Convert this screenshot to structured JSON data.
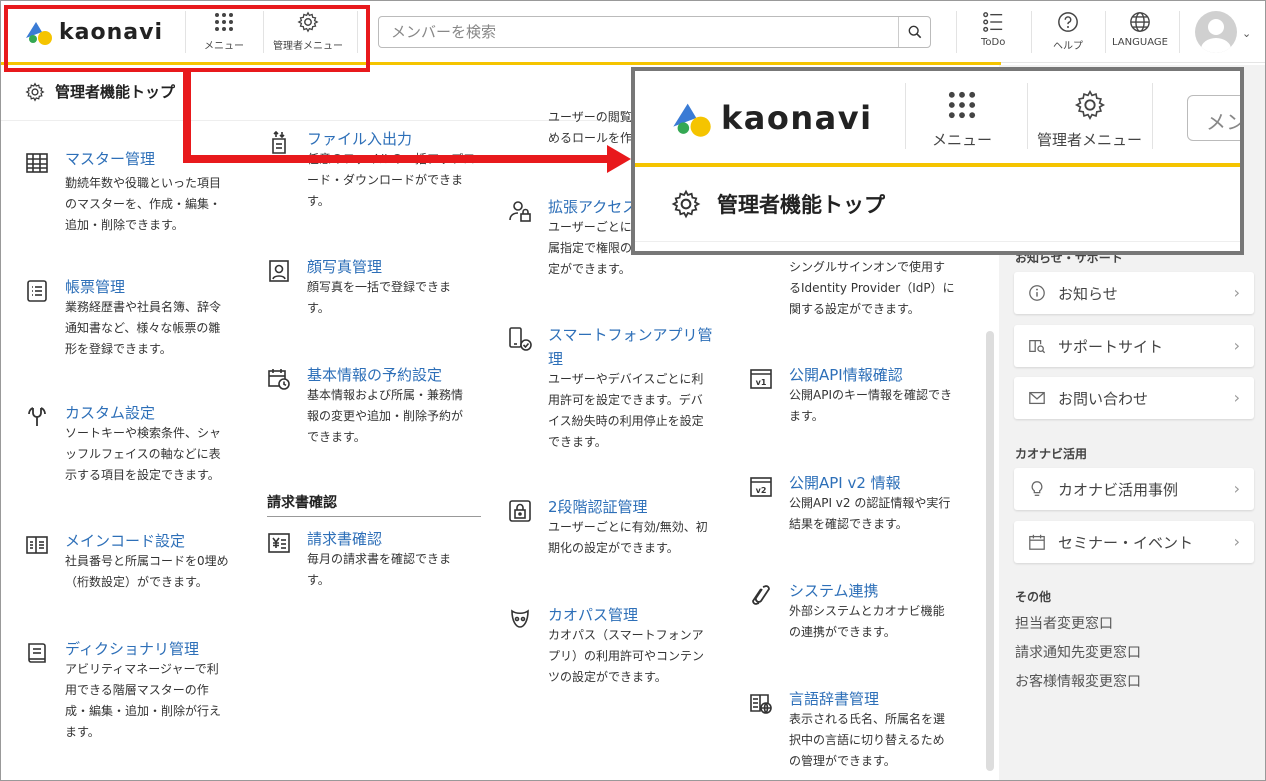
{
  "header": {
    "logo_text": "kaonavi",
    "menu_label": "メニュー",
    "admin_menu_label": "管理者メニュー",
    "search_placeholder": "メンバーを検索",
    "todo_label": "ToDo",
    "help_label": "ヘルプ",
    "language_label": "LANGUAGE"
  },
  "breadcrumb": {
    "title": "管理者機能トップ"
  },
  "main": {
    "col1": [
      {
        "icon": "table-icon",
        "title": "マスター管理",
        "desc": [
          "勤続年数や役職といった項目",
          "のマスターを、作成・編集・",
          "追加・削除できます。"
        ]
      },
      {
        "icon": "list-icon",
        "title": "帳票管理",
        "desc": [
          "業務経歴書や社員名簿、辞令",
          "通知書など、様々な帳票の雛",
          "形を登録できます。"
        ]
      },
      {
        "icon": "wrench-icon",
        "title": "カスタム設定",
        "desc": [
          "ソートキーや検索条件、シャ",
          "ッフルフェイスの軸などに表",
          "示する項目を設定できます。"
        ]
      },
      {
        "icon": "code-icon",
        "title": "メインコード設定",
        "desc": [
          "社員番号と所属コードを0埋め",
          "（桁数設定）ができます。"
        ]
      },
      {
        "icon": "book-icon",
        "title": "ディクショナリ管理",
        "desc": [
          "アビリティマネージャーで利",
          "用できる階層マスターの作",
          "成・編集・追加・削除が行え",
          "ます。"
        ]
      }
    ],
    "col2": [
      {
        "icon": "file-transfer-icon",
        "title": "ファイル入出力",
        "desc": [
          "任意のファイルの一括アップロ",
          "ード・ダウンロードができま",
          "す。"
        ]
      },
      {
        "icon": "portrait-icon",
        "title": "顔写真管理",
        "desc": [
          "顔写真を一括で登録できま",
          "す。"
        ]
      },
      {
        "icon": "calendar-clock-icon",
        "title": "基本情報の予約設定",
        "desc": [
          "基本情報および所属・兼務情",
          "報の変更や追加・削除予約が",
          "できます。"
        ]
      }
    ],
    "billing_header": "請求書確認",
    "billing_item": {
      "icon": "invoice-icon",
      "title": "請求書確認",
      "desc": [
        "毎月の請求書を確認できま",
        "す。"
      ]
    },
    "col3": [
      {
        "icon": "none",
        "title": "",
        "desc": [
          "ユーザーの閲覧",
          "めるロールを作"
        ]
      },
      {
        "icon": "user-lock-icon",
        "title": "拡張アクセス",
        "desc": [
          "ユーザーごとに",
          "属指定で権限の",
          "定ができます。"
        ]
      },
      {
        "icon": "phone-check-icon",
        "title": "スマートフォンアプリ管理",
        "desc": [
          "ユーザーやデバイスごとに利",
          "用許可を設定できます。デバ",
          "イス紛失時の利用停止を設定",
          "できます。"
        ]
      },
      {
        "icon": "two-factor-icon",
        "title": "2段階認証管理",
        "desc": [
          "ユーザーごとに有効/無効、初",
          "期化の設定ができます。"
        ]
      },
      {
        "icon": "kaopass-icon",
        "title": "カオパス管理",
        "desc": [
          "カオパス（スマートフォンア",
          "プリ）の利用許可やコンテン",
          "ツの設定ができます。"
        ]
      }
    ],
    "col4": [
      {
        "icon": "none",
        "title": "",
        "desc": [
          "シングルサインオンで使用す",
          "るIdentity Provider（IdP）に",
          "関する設定ができます。"
        ]
      },
      {
        "icon": "api-v1-icon",
        "title": "公開API情報確認",
        "desc": [
          "公開APIのキー情報を確認でき",
          "ます。"
        ]
      },
      {
        "icon": "api-v2-icon",
        "title": "公開API v2 情報",
        "desc": [
          "公開API v2 の認証情報や実行",
          "結果を確認できます。"
        ]
      },
      {
        "icon": "link-icon",
        "title": "システム連携",
        "desc": [
          "外部システムとカオナビ機能",
          "の連携ができます。"
        ]
      },
      {
        "icon": "language-book-icon",
        "title": "言語辞書管理",
        "desc": [
          "表示される氏名、所属名を選",
          "択中の言語に切り替えるため",
          "の管理ができます。"
        ]
      }
    ]
  },
  "sidebar": {
    "section1_label": "お知らせ・サポート",
    "cards1": [
      "お知らせ",
      "サポートサイト",
      "お問い合わせ"
    ],
    "section2_label": "カオナビ活用",
    "cards2": [
      "カオナビ活用事例",
      "セミナー・イベント"
    ],
    "section3_label": "その他",
    "links": [
      "担当者変更窓口",
      "請求通知先変更窓口",
      "お客様情報変更窓口"
    ]
  },
  "zoom": {
    "logo_text": "kaonavi",
    "menu_label": "メニュー",
    "admin_menu_label": "管理者メニュー",
    "search_partial": "メン",
    "crumb_title": "管理者機能トップ"
  },
  "colors": {
    "accent_yellow": "#f5c400",
    "link_blue": "#2d6fb8",
    "callout_red": "#e8191c"
  }
}
